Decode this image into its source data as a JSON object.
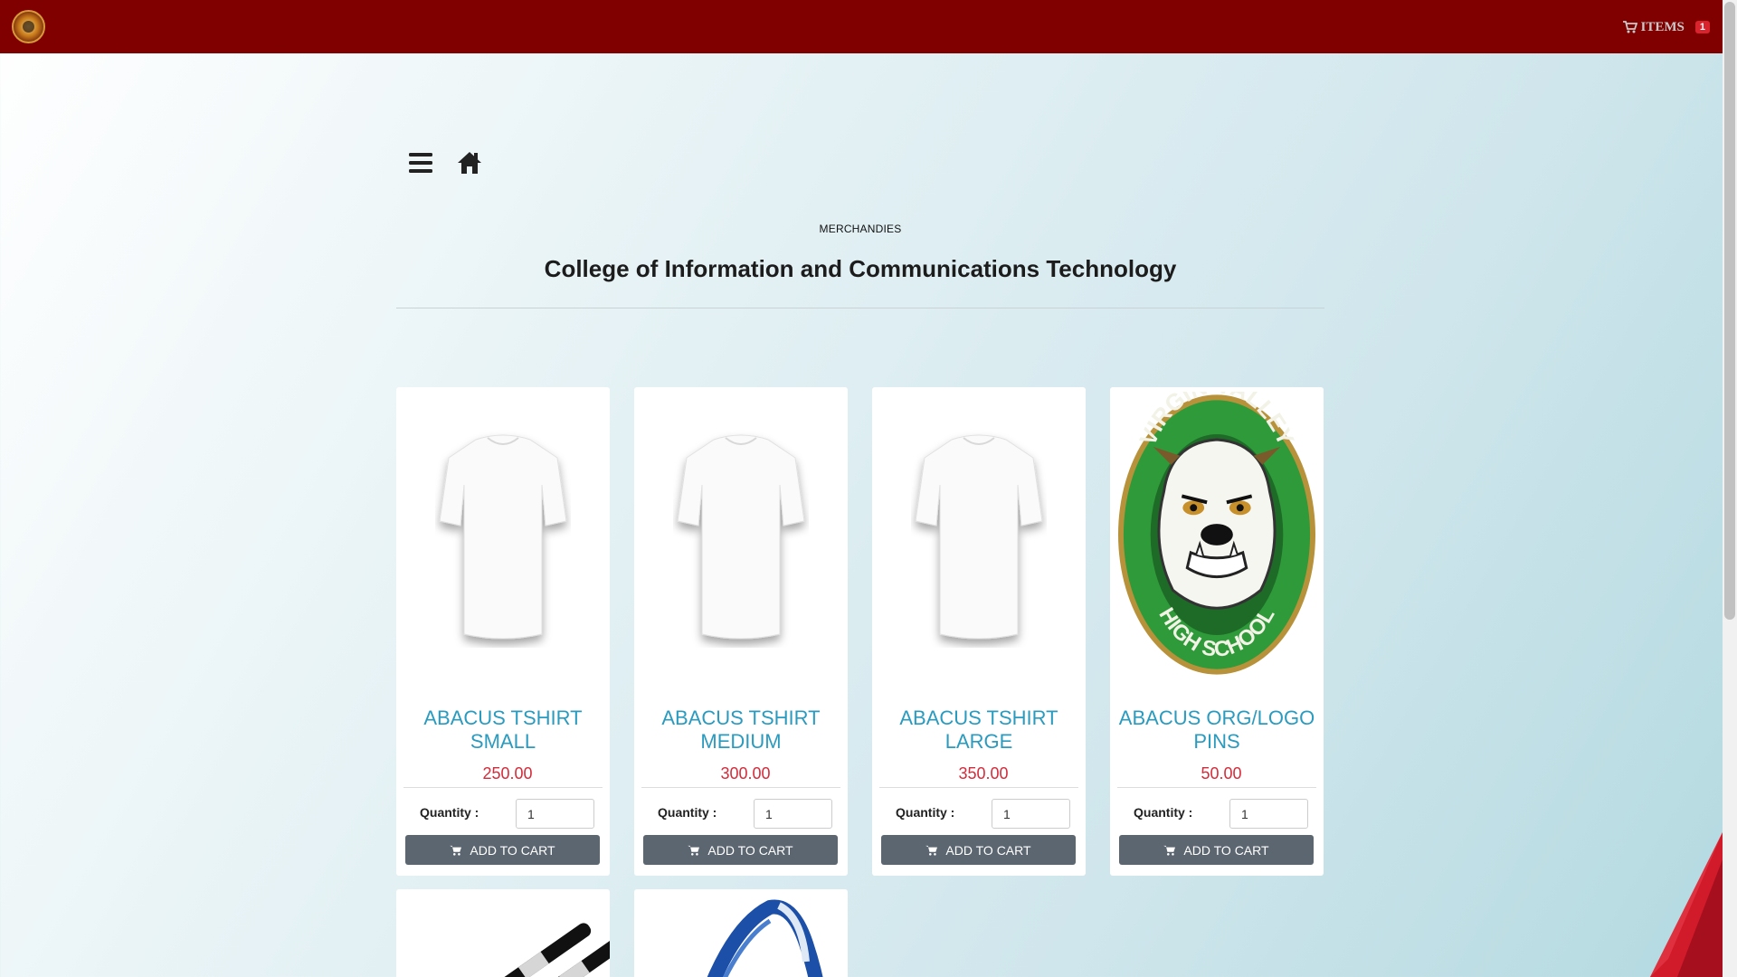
{
  "navbar": {
    "cart_label": "ITEMS",
    "cart_count": "1"
  },
  "header": {
    "section_label": "MERCHANDIES",
    "title": "College of Information and Communications Technology"
  },
  "products": [
    {
      "name": "ABACUS TSHIRT SMALL",
      "price": "250.00",
      "quantity_label": "Quantity :",
      "quantity": "1",
      "button": "ADD TO CART",
      "image": "white-tshirt"
    },
    {
      "name": "ABACUS TSHIRT MEDIUM",
      "price": "300.00",
      "quantity_label": "Quantity :",
      "quantity": "1",
      "button": "ADD TO CART",
      "image": "white-tshirt"
    },
    {
      "name": "ABACUS TSHIRT LARGE",
      "price": "350.00",
      "quantity_label": "Quantity :",
      "quantity": "1",
      "button": "ADD TO CART",
      "image": "white-tshirt"
    },
    {
      "name": "ABACUS ORG/LOGO PINS",
      "price": "50.00",
      "quantity_label": "Quantity :",
      "quantity": "1",
      "button": "ADD TO CART",
      "image": "bulldog-pin",
      "pin_top_text": "VIRGIN VALLEY",
      "pin_bottom_text": "HIGH SCHOOL"
    }
  ],
  "more_products": [
    {
      "image": "pens"
    },
    {
      "image": "lanyard"
    }
  ],
  "icons": {
    "brand": "school-logo-icon",
    "cart": "cart-icon",
    "menu": "hamburger-menu-icon",
    "home": "home-icon"
  },
  "colors": {
    "navbar": "#800000",
    "product_name": "#2a9bbf",
    "price": "#d42b3a",
    "button": "#5c6670",
    "badge": "#d9232d"
  }
}
